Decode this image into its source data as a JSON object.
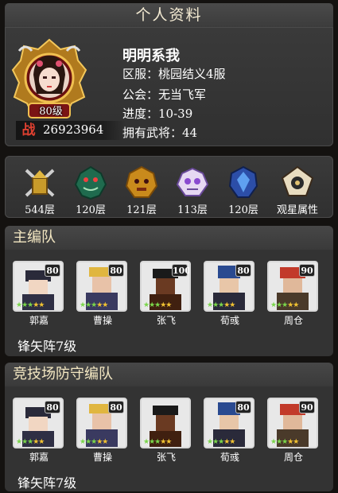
{
  "header": {
    "title": "个人资料"
  },
  "profile": {
    "name": "明明系我",
    "level": "80级",
    "server": {
      "label": "区服：",
      "value": "桃园结义4服"
    },
    "guild": {
      "label": "公会：",
      "value": "无当飞军"
    },
    "progress": {
      "label": "进度：",
      "value": "10-39"
    },
    "generals": {
      "label": "拥有武将：",
      "value": "44"
    },
    "power_icon": "战",
    "power": "26923964"
  },
  "towers": [
    {
      "icon": "crossed-swords-tower-icon",
      "label": "544层"
    },
    {
      "icon": "jade-dragon-tower-icon",
      "label": "120层"
    },
    {
      "icon": "golden-beast-tower-icon",
      "label": "121层"
    },
    {
      "icon": "purple-demon-tower-icon",
      "label": "113层"
    },
    {
      "icon": "blue-armor-tower-icon",
      "label": "120层"
    },
    {
      "icon": "star-scroll-icon",
      "label": "观星属性"
    }
  ],
  "main_team": {
    "title": "主编队",
    "formation": "锋矢阵7级",
    "heroes": [
      {
        "name": "郭嘉",
        "level": "80"
      },
      {
        "name": "曹操",
        "level": "80"
      },
      {
        "name": "张飞",
        "level": "100"
      },
      {
        "name": "荀彧",
        "level": "80"
      },
      {
        "name": "周仓",
        "level": "90"
      }
    ]
  },
  "arena_team": {
    "title": "竞技场防守编队",
    "formation": "锋矢阵7级",
    "heroes": [
      {
        "name": "郭嘉",
        "level": "80"
      },
      {
        "name": "曹操",
        "level": "80"
      },
      {
        "name": "张飞",
        "level": ""
      },
      {
        "name": "荀彧",
        "level": "80"
      },
      {
        "name": "周仓",
        "level": "90"
      }
    ]
  },
  "colors": {
    "panel": "#333333",
    "accent_gold": "#d9a83a",
    "power_red": "#e04030"
  }
}
